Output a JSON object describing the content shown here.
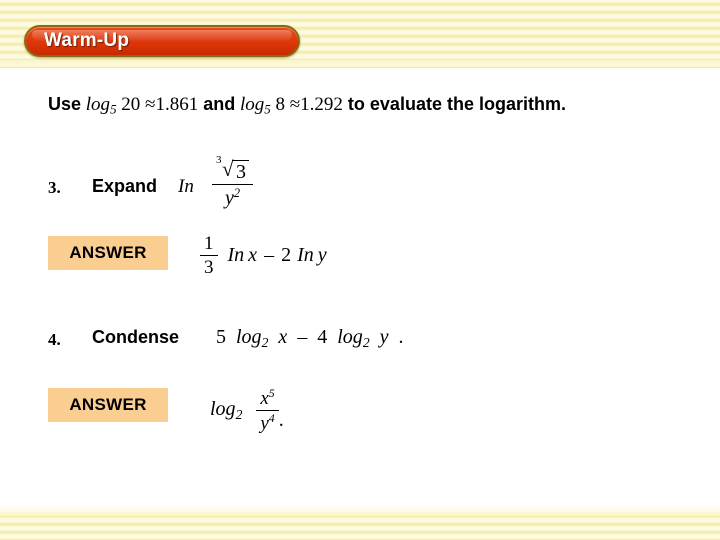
{
  "slide": {
    "title": "Warm-Up",
    "background_color": "#ffffff",
    "band_color": "#fbf6cd",
    "banner_color": "#d83205",
    "banner_border_color": "#8a6a10",
    "answer_box_color": "#facd91"
  },
  "prompt": {
    "lead": "Use",
    "log_word_1": "log",
    "base_1": "5",
    "arg_1": "20",
    "approx_1": "≈1.861",
    "conjunction": "and",
    "log_word_2": "log",
    "base_2": "5",
    "arg_2": "8",
    "approx_2": "≈1.292",
    "tail": "to evaluate the logarithm."
  },
  "problems": [
    {
      "number": "3.",
      "verb": "Expand",
      "operator": "In",
      "radical_index": "3",
      "radicand": "3",
      "denominator_base": "y",
      "denominator_exponent": "2",
      "answer_label": "ANSWER",
      "answer": {
        "coefficient_numerator": "1",
        "coefficient_denominator": "3",
        "term_1_op": "In",
        "term_1_var": "x",
        "minus": "–",
        "term_2_coefficient": "2",
        "term_2_op": "In",
        "term_2_var": "y"
      }
    },
    {
      "number": "4.",
      "verb": "Condense",
      "expression": {
        "coefficient_1": "5",
        "log_word_1": "log",
        "base_1": "2",
        "var_1": "x",
        "minus": "–",
        "coefficient_2": "4",
        "log_word_2": "log",
        "base_2": "2",
        "var_2": "y",
        "period": "."
      },
      "answer_label": "ANSWER",
      "answer": {
        "log_word": "log",
        "base": "2",
        "numerator_base": "x",
        "numerator_exponent": "5",
        "denominator_base": "y",
        "denominator_exponent": "4",
        "period": "."
      }
    }
  ]
}
